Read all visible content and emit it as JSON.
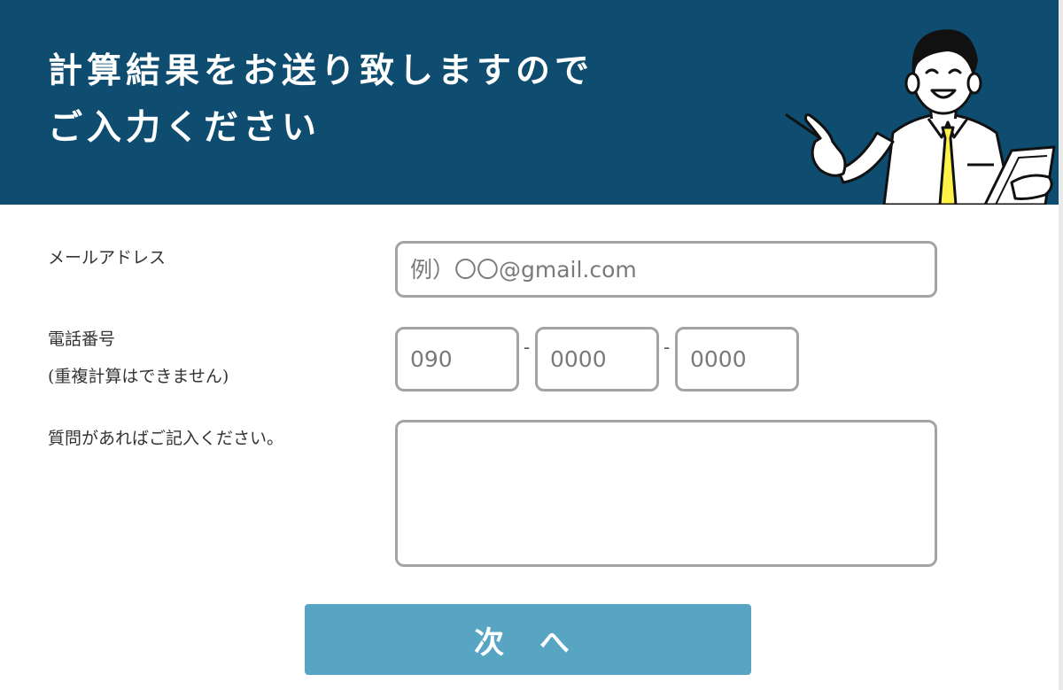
{
  "header": {
    "title_line1": "計算結果をお送り致しますので",
    "title_line2": "ご入力ください",
    "illustration_icon": "presenter-man-pointing-icon",
    "bg_color": "#0e4c70",
    "tie_color": "#fff34a"
  },
  "form": {
    "email": {
      "label": "メールアドレス",
      "placeholder": "例）〇〇@gmail.com",
      "value": ""
    },
    "phone": {
      "label_line1": "電話番号",
      "label_line2": "(重複計算はできません)",
      "part1_placeholder": "090",
      "part2_placeholder": "0000",
      "part3_placeholder": "0000",
      "separator": "-"
    },
    "question": {
      "label": "質問があればご記入ください。",
      "value": ""
    }
  },
  "next_button": {
    "label": "次 へ",
    "color": "#58a5c3"
  }
}
